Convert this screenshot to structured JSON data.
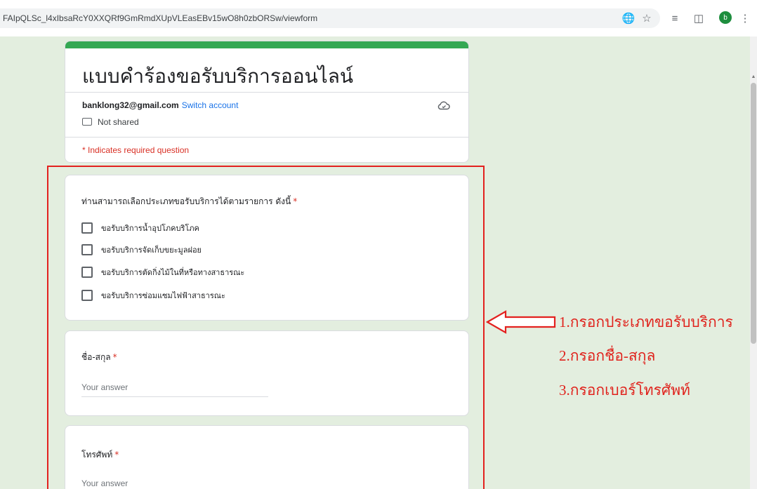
{
  "browser": {
    "url": "FAIpQLSc_l4xIbsaRcY0XXQRf9GmRmdXUpVLEasEBv15wO8h0zbORSw/viewform",
    "avatar_letter": "b"
  },
  "form": {
    "title": "แบบคำร้องขอรับบริการออนไลน์",
    "account_email": "banklong32@gmail.com",
    "switch_account": "Switch account",
    "not_shared": "Not shared",
    "required_note": "* Indicates required question"
  },
  "questions": [
    {
      "title": "ท่านสามารถเลือกประเภทขอรับบริการได้ตามรายการ ดังนี้",
      "required_mark": "*",
      "options": [
        "ขอรับบริการน้ำอุปโภคบริโภค",
        "ขอรับบริการจัดเก็บขยะมูลฝอย",
        "ขอรับบริการตัดกิ่งไม้ในที่หรือทางสาธารณะ",
        "ขอรับบริการซ่อมแซมไฟฟ้าสาธารณะ"
      ]
    },
    {
      "title": "ชื่อ-สกุล",
      "required_mark": "*",
      "placeholder": "Your answer"
    },
    {
      "title": "โทรศัพท์",
      "required_mark": "*",
      "placeholder": "Your answer"
    }
  ],
  "annotations": [
    "1.กรอกประเภทขอรับบริการ",
    "2.กรอกชื่อ-สกุล",
    "3.กรอกเบอร์โทรศัพท์"
  ],
  "colors": {
    "accent_stripe": "#34a853",
    "annotation_red": "#e3211f",
    "link_blue": "#1a73e8",
    "required_red": "#d93025"
  }
}
